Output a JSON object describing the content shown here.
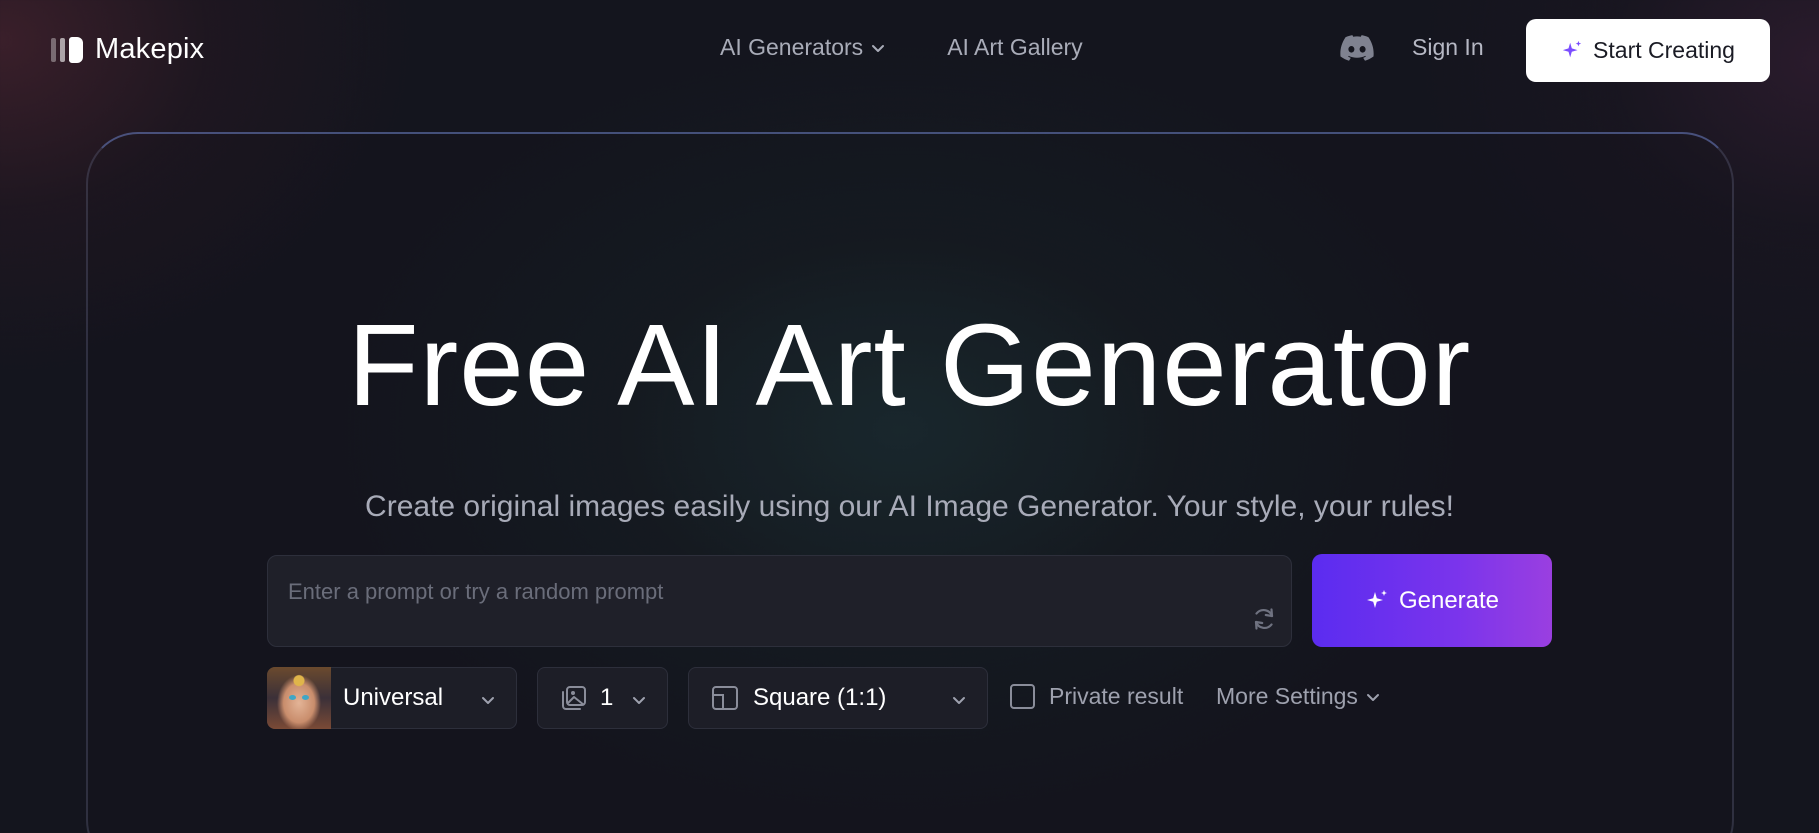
{
  "brand": {
    "name": "Makepix"
  },
  "nav": {
    "generators": "AI Generators",
    "gallery": "AI Art Gallery"
  },
  "header": {
    "discord_icon": "discord-icon",
    "sign_in": "Sign In",
    "start_creating": "Start Creating"
  },
  "hero": {
    "title": "Free AI Art Generator",
    "subtitle": "Create original images easily using our AI Image Generator. Your style, your rules!"
  },
  "prompt": {
    "placeholder": "Enter a prompt or try a random prompt",
    "value": ""
  },
  "generate": {
    "label": "Generate"
  },
  "controls": {
    "model": "Universal",
    "count": "1",
    "ratio": "Square (1:1)",
    "private_label": "Private result",
    "private_checked": false,
    "more_settings": "More Settings"
  },
  "colors": {
    "background": "#14151e",
    "accent_start": "#5b2cf0",
    "accent_end": "#9a3fe0",
    "sparkle": "#7b4dff"
  }
}
